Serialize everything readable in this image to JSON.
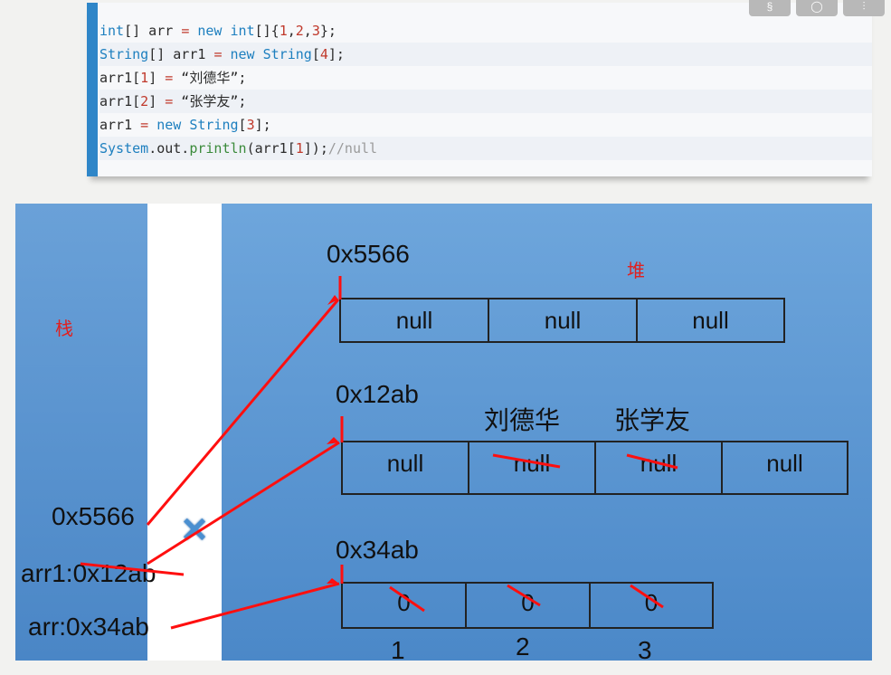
{
  "code": {
    "lines": [
      [
        {
          "t": "int",
          "c": "kw"
        },
        {
          "t": "[] arr ",
          "c": ""
        },
        {
          "t": "=",
          "c": "num"
        },
        {
          "t": " ",
          "c": ""
        },
        {
          "t": "new",
          "c": "kw"
        },
        {
          "t": " ",
          "c": ""
        },
        {
          "t": "int",
          "c": "kw"
        },
        {
          "t": "[]{",
          "c": ""
        },
        {
          "t": "1",
          "c": "num"
        },
        {
          "t": ",",
          "c": ""
        },
        {
          "t": "2",
          "c": "num"
        },
        {
          "t": ",",
          "c": ""
        },
        {
          "t": "3",
          "c": "num"
        },
        {
          "t": "};",
          "c": ""
        }
      ],
      [
        {
          "t": "String",
          "c": "kw"
        },
        {
          "t": "[] arr1 ",
          "c": ""
        },
        {
          "t": "=",
          "c": "num"
        },
        {
          "t": " ",
          "c": ""
        },
        {
          "t": "new",
          "c": "kw"
        },
        {
          "t": " ",
          "c": ""
        },
        {
          "t": "String",
          "c": "kw"
        },
        {
          "t": "[",
          "c": ""
        },
        {
          "t": "4",
          "c": "num"
        },
        {
          "t": "];",
          "c": ""
        }
      ],
      [
        {
          "t": "arr1[",
          "c": ""
        },
        {
          "t": "1",
          "c": "num"
        },
        {
          "t": "] ",
          "c": ""
        },
        {
          "t": "=",
          "c": "num"
        },
        {
          "t": " “刘德华”;",
          "c": ""
        }
      ],
      [
        {
          "t": "arr1[",
          "c": ""
        },
        {
          "t": "2",
          "c": "num"
        },
        {
          "t": "] ",
          "c": ""
        },
        {
          "t": "=",
          "c": "num"
        },
        {
          "t": " “张学友”;",
          "c": ""
        }
      ],
      [
        {
          "t": "arr1 ",
          "c": ""
        },
        {
          "t": "=",
          "c": "num"
        },
        {
          "t": " ",
          "c": ""
        },
        {
          "t": "new",
          "c": "kw"
        },
        {
          "t": " ",
          "c": ""
        },
        {
          "t": "String",
          "c": "kw"
        },
        {
          "t": "[",
          "c": ""
        },
        {
          "t": "3",
          "c": "num"
        },
        {
          "t": "];",
          "c": ""
        }
      ],
      [
        {
          "t": "System",
          "c": "kw"
        },
        {
          "t": ".out.",
          "c": ""
        },
        {
          "t": "println",
          "c": "fn"
        },
        {
          "t": "(arr1[",
          "c": ""
        },
        {
          "t": "1",
          "c": "num"
        },
        {
          "t": "]);",
          "c": ""
        },
        {
          "t": "//null",
          "c": "cm"
        }
      ]
    ]
  },
  "toolbar": {
    "buttons": [
      "§",
      "◯",
      "⫶"
    ]
  },
  "diagram": {
    "stack_label": "栈",
    "heap_label": "堆",
    "stack_vars": [
      "0x5566",
      "arr1:0x12ab",
      "arr:0x34ab"
    ],
    "cross_mark": "×",
    "heap_arrays": [
      {
        "address": "0x5566",
        "cells": [
          "null",
          "null",
          "null"
        ]
      },
      {
        "address": "0x12ab",
        "cells": [
          "null",
          "null",
          "null",
          "null"
        ],
        "assigned": [
          "",
          "刘德华",
          "张学友",
          ""
        ]
      },
      {
        "address": "0x34ab",
        "cells": [
          "0",
          "0",
          "0"
        ],
        "assigned": [
          "1",
          "2",
          "3"
        ]
      }
    ]
  }
}
